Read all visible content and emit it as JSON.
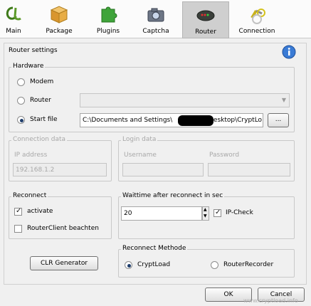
{
  "toolbar": {
    "items": [
      {
        "label": "Main",
        "icon": "cl-logo-icon"
      },
      {
        "label": "Package",
        "icon": "box-icon"
      },
      {
        "label": "Plugins",
        "icon": "puzzle-icon"
      },
      {
        "label": "Captcha",
        "icon": "camera-icon"
      },
      {
        "label": "Router",
        "icon": "router-icon",
        "active": true
      },
      {
        "label": "Connection",
        "icon": "connection-icon"
      }
    ]
  },
  "router_settings": {
    "title": "Router settings",
    "hardware": {
      "legend": "Hardware",
      "modem_label": "Modem",
      "router_label": "Router",
      "startfile_label": "Start file",
      "selected": "Start file",
      "router_select_value": "",
      "startfile_path": "C:\\Documents and Settings\\",
      "startfile_path_tail": "Desktop\\CryptLo",
      "browse_label": "..."
    },
    "connection_data": {
      "legend": "Connection data",
      "ip_label": "IP address",
      "ip_value": "192.168.1.2"
    },
    "login_data": {
      "legend": "Login data",
      "username_label": "Username",
      "password_label": "Password",
      "username_value": "",
      "password_value": ""
    },
    "reconnect": {
      "legend": "Reconnect",
      "activate_label": "activate",
      "activate_checked": true,
      "routerclient_label": "RouterClient beachten",
      "routerclient_checked": false
    },
    "waittime": {
      "legend": "Waittime after reconnect in sec",
      "value": "20",
      "ipcheck_label": "IP-Check",
      "ipcheck_checked": true
    },
    "clr_button": "CLR Generator",
    "reconnect_method": {
      "legend": "Reconnect Methode",
      "cryptload_label": "CryptLoad",
      "routerrecorder_label": "RouterRecorder",
      "selected": "CryptLoad"
    }
  },
  "footer": {
    "ok_label": "OK",
    "cancel_label": "Cancel",
    "watermark": "www.cryptload.info"
  },
  "colors": {
    "toolbar_bg": "#fbfbfb",
    "panel_bg": "#f0f0f0",
    "active_tab_bg": "#cfcfcf",
    "radio_dot": "#1e3d6b",
    "info_icon": "#3a7bd5"
  }
}
